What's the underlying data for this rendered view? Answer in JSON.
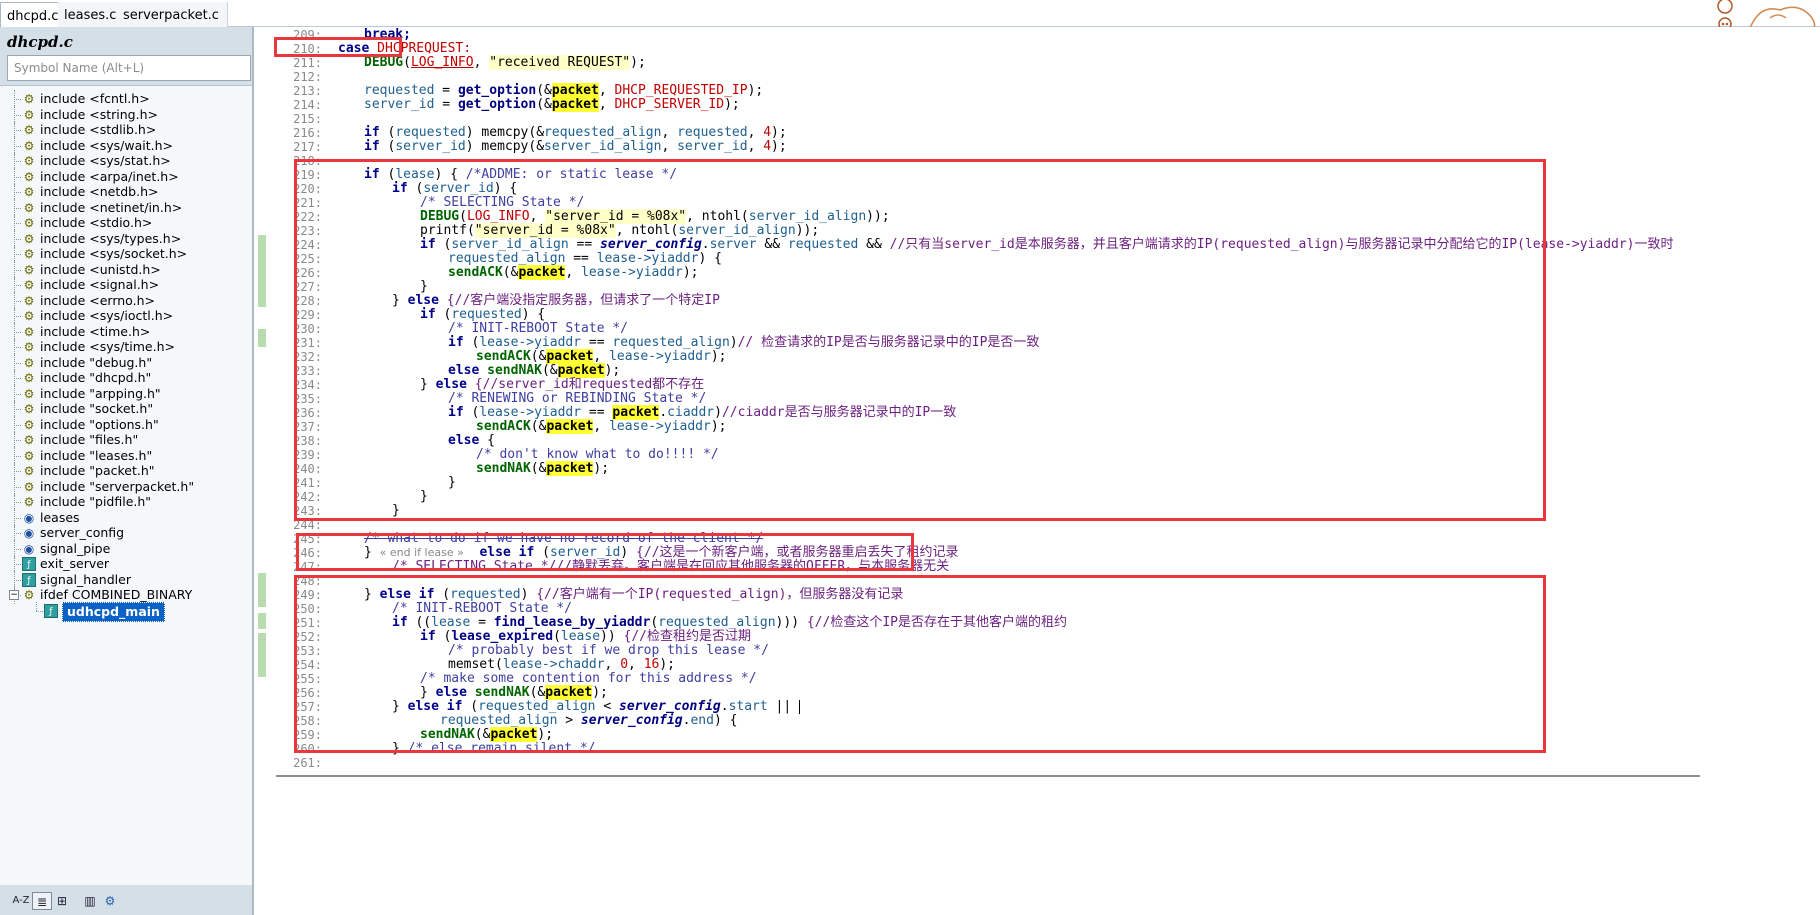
{
  "tabs": [
    {
      "label": "dhcpd.c",
      "close": "×",
      "active": true
    },
    {
      "label": "leases.c",
      "active": false
    },
    {
      "label": "serverpacket.c",
      "active": false
    }
  ],
  "sidebar": {
    "title": "dhcpd.c",
    "search_placeholder": "Symbol Name (Alt+L)",
    "items": [
      {
        "label": "include <fcntl.h>",
        "icon": "include-icon"
      },
      {
        "label": "include <string.h>",
        "icon": "include-icon"
      },
      {
        "label": "include <stdlib.h>",
        "icon": "include-icon"
      },
      {
        "label": "include <sys/wait.h>",
        "icon": "include-icon"
      },
      {
        "label": "include <sys/stat.h>",
        "icon": "include-icon"
      },
      {
        "label": "include <arpa/inet.h>",
        "icon": "include-icon"
      },
      {
        "label": "include <netdb.h>",
        "icon": "include-icon"
      },
      {
        "label": "include <netinet/in.h>",
        "icon": "include-icon"
      },
      {
        "label": "include <stdio.h>",
        "icon": "include-icon"
      },
      {
        "label": "include <sys/types.h>",
        "icon": "include-icon"
      },
      {
        "label": "include <sys/socket.h>",
        "icon": "include-icon"
      },
      {
        "label": "include <unistd.h>",
        "icon": "include-icon"
      },
      {
        "label": "include <signal.h>",
        "icon": "include-icon"
      },
      {
        "label": "include <errno.h>",
        "icon": "include-icon"
      },
      {
        "label": "include <sys/ioctl.h>",
        "icon": "include-icon"
      },
      {
        "label": "include <time.h>",
        "icon": "include-icon"
      },
      {
        "label": "include <sys/time.h>",
        "icon": "include-icon"
      },
      {
        "label": "include \"debug.h\"",
        "icon": "include-icon"
      },
      {
        "label": "include \"dhcpd.h\"",
        "icon": "include-icon"
      },
      {
        "label": "include \"arpping.h\"",
        "icon": "include-icon"
      },
      {
        "label": "include \"socket.h\"",
        "icon": "include-icon"
      },
      {
        "label": "include \"options.h\"",
        "icon": "include-icon"
      },
      {
        "label": "include \"files.h\"",
        "icon": "include-icon"
      },
      {
        "label": "include \"leases.h\"",
        "icon": "include-icon"
      },
      {
        "label": "include \"packet.h\"",
        "icon": "include-icon"
      },
      {
        "label": "include \"serverpacket.h\"",
        "icon": "include-icon"
      },
      {
        "label": "include \"pidfile.h\"",
        "icon": "include-icon"
      },
      {
        "label": "leases",
        "icon": "variable-icon"
      },
      {
        "label": "server_config",
        "icon": "variable-icon"
      },
      {
        "label": "signal_pipe",
        "icon": "variable-icon"
      },
      {
        "label": "exit_server",
        "icon": "function-icon"
      },
      {
        "label": "signal_handler",
        "icon": "function-icon"
      },
      {
        "label": "ifdef COMBINED_BINARY",
        "icon": "include-icon",
        "expander": "⊟"
      },
      {
        "label": "udhcpd_main",
        "icon": "function-icon",
        "selected": true
      }
    ],
    "toolbar": [
      "A-Z",
      "≣",
      "⊞",
      "▥",
      "⚙"
    ]
  },
  "editor": {
    "line_numbers": [
      "209:",
      "210:",
      "211:",
      "212:",
      "213:",
      "214:",
      "215:",
      "216:",
      "217:",
      "218:",
      "219:",
      "220:",
      "221:",
      "222:",
      "223:",
      "224:",
      "225:",
      "226:",
      "227:",
      "228:",
      "229:",
      "230:",
      "231:",
      "232:",
      "233:",
      "234:",
      "235:",
      "236:",
      "237:",
      "238:",
      "239:",
      "240:",
      "241:",
      "242:",
      "243:",
      "244:",
      "245:",
      "246:",
      "247:",
      "248:",
      "249:",
      "250:",
      "251:",
      "252:",
      "253:",
      "254:",
      "255:",
      "256:",
      "257:",
      "258:",
      "259:",
      "260:",
      "261:"
    ],
    "end_if_tag": "« end if lease »",
    "code_tokens": {
      "l209_break": "break;",
      "l210_case": "case",
      "l210_macro": "DHCPREQUEST:",
      "l211_debug": "DEBUG",
      "l211_loginfo": "LOG_INFO",
      "l211_str": "\"received REQUEST\"",
      "l213_var": "requested",
      "l213_fn": "get_option",
      "l213_pkt": "packet",
      "l213_mac": "DHCP_REQUESTED_IP",
      "l214_var": "server_id",
      "l214_mac": "DHCP_SERVER_ID",
      "l224_comment": "//只有当server_id是本服务器，并且客户端请求的IP(requested_align)与服务器记录中分配给它的IP(lease->yiaddr)一致时",
      "l228_comment": "{//客户端没指定服务器，但请求了一个特定IP",
      "l231_comment": "// 检查请求的IP是否与服务器记录中的IP是否一致",
      "l234_comment": "{//server_id和requested都不存在",
      "l236_comment": "//ciaddr是否与服务器记录中的IP一致",
      "l246_comment": "{//这是一个新客户端，或者服务器重启丢失了租约记录",
      "l247_comment": "/* SELECTING State *///静默丢弃。客户端是在回应其他服务器的OFFER，与本服务器无关",
      "l249_comment": "{//客户端有一个IP(requested_align)，但服务器没有记录",
      "l251_comment": "{//检查这个IP是否存在于其他客户端的租约",
      "l252_comment": "{//检查租约是否过期"
    }
  }
}
